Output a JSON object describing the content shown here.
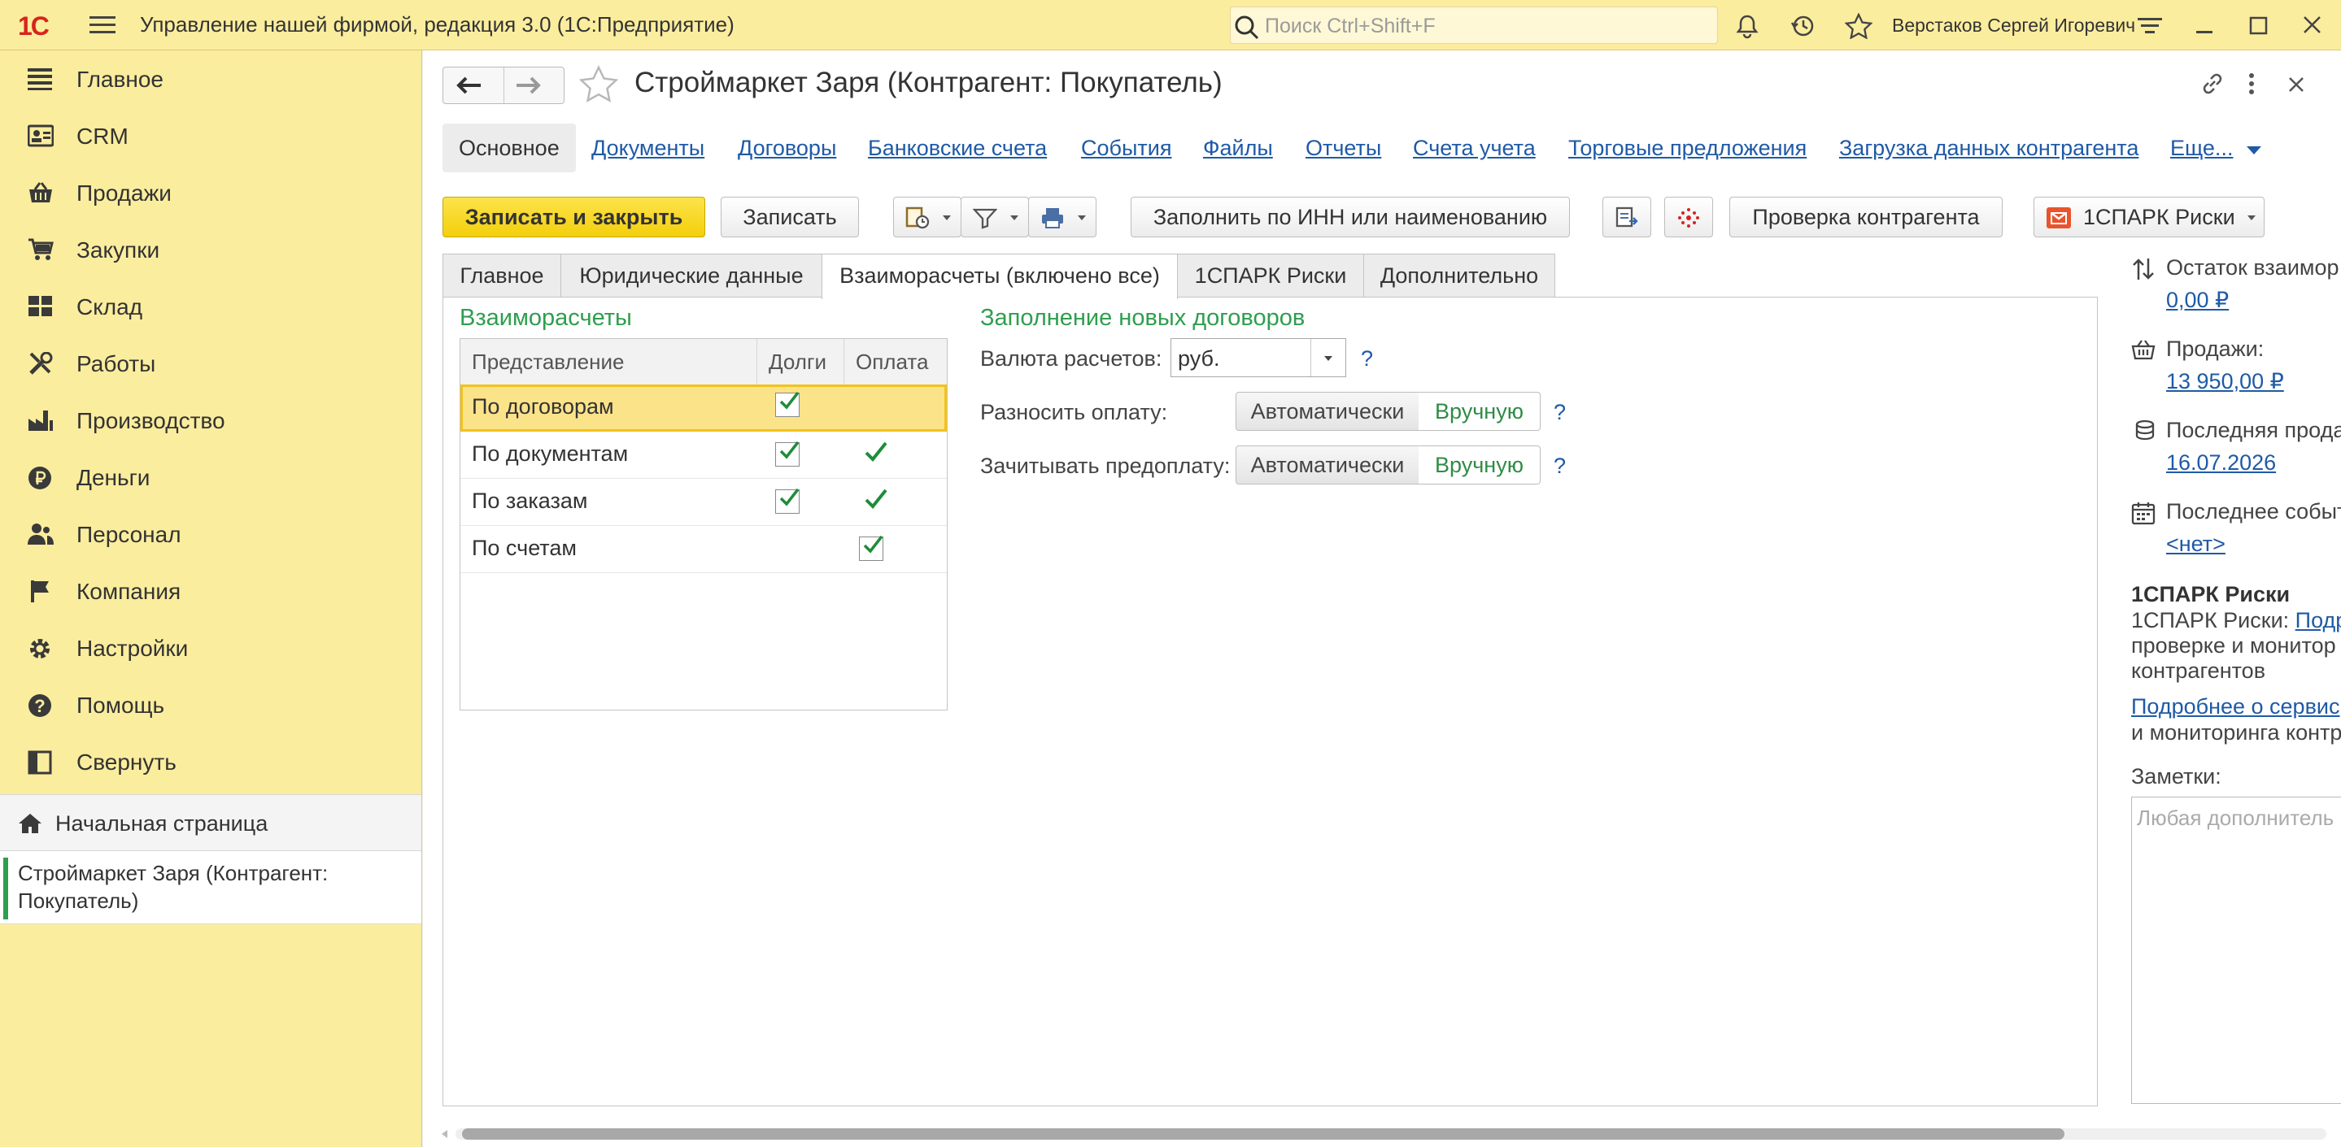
{
  "app": {
    "logo": "1С",
    "title": "Управление нашей фирмой, редакция 3.0  (1С:Предприятие)",
    "search_placeholder": "Поиск Ctrl+Shift+F",
    "user": "Верстаков Сергей Игоревич"
  },
  "sidebar": {
    "items": [
      {
        "label": "Главное",
        "icon": "list-icon"
      },
      {
        "label": "CRM",
        "icon": "contact-card-icon"
      },
      {
        "label": "Продажи",
        "icon": "basket-icon"
      },
      {
        "label": "Закупки",
        "icon": "cart-icon"
      },
      {
        "label": "Склад",
        "icon": "grid-icon"
      },
      {
        "label": "Работы",
        "icon": "tools-icon"
      },
      {
        "label": "Производство",
        "icon": "factory-icon"
      },
      {
        "label": "Деньги",
        "icon": "ruble-coin-icon"
      },
      {
        "label": "Персонал",
        "icon": "people-icon"
      },
      {
        "label": "Компания",
        "icon": "flag-icon"
      },
      {
        "label": "Настройки",
        "icon": "gear-icon"
      },
      {
        "label": "Помощь",
        "icon": "help-icon"
      },
      {
        "label": "Свернуть",
        "icon": "collapse-panel-icon"
      }
    ],
    "home": "Начальная страница",
    "open_window": "Строймаркет Заря (Контрагент: Покупатель)"
  },
  "form": {
    "title": "Строймаркет Заря (Контрагент: Покупатель)",
    "link_tabs": [
      "Основное",
      "Документы",
      "Договоры",
      "Банковские счета",
      "События",
      "Файлы",
      "Отчеты",
      "Счета учета",
      "Торговые предложения",
      "Загрузка данных контрагента",
      "Еще..."
    ],
    "toolbar": {
      "save_close": "Записать и закрыть",
      "save": "Записать",
      "fill_inn": "Заполнить по ИНН или наименованию",
      "check": "Проверка контрагента",
      "spark": "1СПАРК Риски"
    },
    "tabs": [
      "Главное",
      "Юридические данные",
      "Взаиморасчеты (включено все)",
      "1СПАРК Риски",
      "Дополнительно"
    ],
    "settlements": {
      "title": "Взаиморасчеты",
      "columns": [
        "Представление",
        "Долги",
        "Оплата"
      ],
      "rows": [
        {
          "label": "По договорам",
          "debts": true,
          "payment": false
        },
        {
          "label": "По документам",
          "debts": true,
          "payment": true
        },
        {
          "label": "По заказам",
          "debts": true,
          "payment": true
        },
        {
          "label": "По счетам",
          "debts": false,
          "payment": true
        }
      ]
    },
    "new_contracts": {
      "title": "Заполнение новых договоров",
      "currency_label": "Валюта расчетов:",
      "currency_value": "руб.",
      "allocate_label": "Разносить оплату:",
      "offset_label": "Зачитывать предоплату:",
      "auto": "Автоматически",
      "manual": "Вручную",
      "help": "?"
    },
    "info": {
      "balance_label": "Остаток взаимор",
      "balance_value": "0,00 ₽",
      "sales_label": "Продажи:",
      "sales_value": "13 950,00 ₽",
      "last_sale_label": "Последняя прода",
      "last_sale_value": "16.07.2026",
      "last_event_label": "Последнее событ",
      "last_event_value": "<нет>",
      "spark_title": "1СПАРК Риски",
      "spark_text_1": "1СПАРК Риски: ",
      "spark_link_1": "Подр",
      "spark_text_2": "проверке и монитор",
      "spark_text_3": "контрагентов",
      "spark_link_2": "Подробнее о сервис",
      "spark_text_4": "и мониторинга контр",
      "notes_label": "Заметки:",
      "notes_placeholder": "Любая дополнитель"
    }
  }
}
